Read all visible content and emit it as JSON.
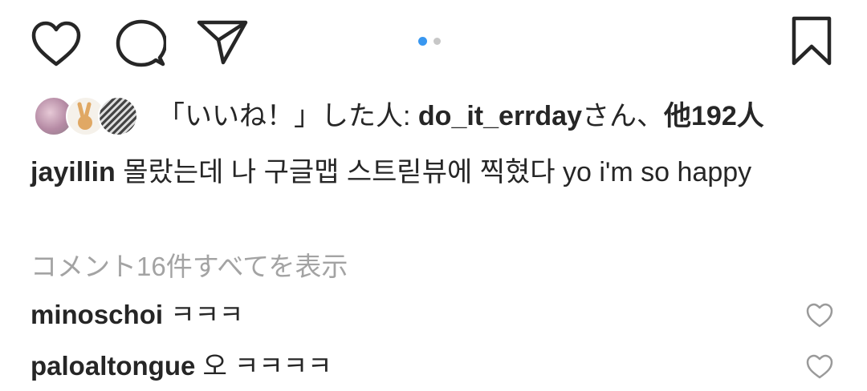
{
  "actions": {
    "like_icon": "heart-outline",
    "comment_icon": "comment-bubble",
    "share_icon": "paper-plane",
    "save_icon": "bookmark-outline"
  },
  "carousel": {
    "active_color": "#3897f0",
    "inactive_color": "#c7c7c7"
  },
  "likes": {
    "prefix": "「いいね！」した人: ",
    "user": "do_it_errday",
    "suffix": "さん、",
    "others": "他192人"
  },
  "caption": {
    "username": "jayillin",
    "text": "몰랐는데 나 구글맵 스트릳뷰에 찍혔다 yo i'm so happy"
  },
  "view_all_comments": "コメント16件すべてを表示",
  "comments": [
    {
      "username": "minoschoi",
      "text": "ㅋㅋㅋ"
    },
    {
      "username": "paloaltongue",
      "text": "오 ㅋㅋㅋㅋ"
    }
  ]
}
